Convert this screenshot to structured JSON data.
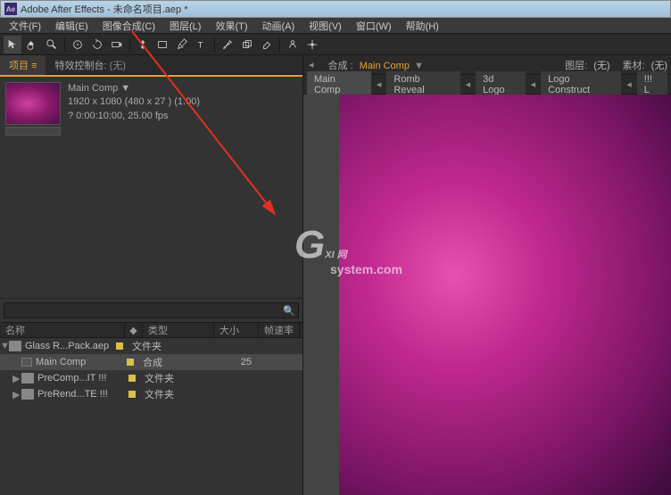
{
  "title": "Adobe After Effects - 未命名项目.aep *",
  "menus": [
    "文件(F)",
    "编辑(E)",
    "图像合成(C)",
    "图层(L)",
    "效果(T)",
    "动画(A)",
    "视图(V)",
    "窗口(W)",
    "帮助(H)"
  ],
  "panel_tabs": {
    "project": "项目",
    "effects": "特效控制台",
    "effects_val": "(无)"
  },
  "thumb_info": {
    "name": "Main Comp ▼",
    "dim": "1920 x 1080  (480 x 27   ) (1.00)",
    "dur": "? 0:00:10:00, 25.00 fps"
  },
  "columns": {
    "name": "名称",
    "tag": "◆",
    "type": "类型",
    "size": "大小",
    "rate": "帧速率"
  },
  "tree": [
    {
      "indent": 0,
      "arrow": "▼",
      "icon": "folder",
      "name": "Glass R...Pack.aep",
      "tag": true,
      "type": "文件夹",
      "size": ""
    },
    {
      "indent": 1,
      "arrow": "",
      "icon": "comp",
      "name": "Main Comp",
      "tag": true,
      "type": "合成",
      "size": "25",
      "sel": true
    },
    {
      "indent": 1,
      "arrow": "▶",
      "icon": "folder",
      "name": "PreComp...IT !!!",
      "tag": true,
      "type": "文件夹",
      "size": ""
    },
    {
      "indent": 1,
      "arrow": "▶",
      "icon": "folder",
      "name": "PreRend...TE !!!",
      "tag": true,
      "type": "文件夹",
      "size": ""
    }
  ],
  "comp_header": {
    "comp_label": "合成 :",
    "comp_name": "Main Comp",
    "layer_label": "图层:",
    "layer_val": "(无)",
    "footage_label": "素材:",
    "footage_val": "(无)"
  },
  "comp_tabs": [
    "Main Comp",
    "Romb Reveal",
    "3d Logo",
    "Logo Construct",
    "!!! L"
  ],
  "watermark": {
    "main": "XI 网",
    "sub": "system.com"
  }
}
